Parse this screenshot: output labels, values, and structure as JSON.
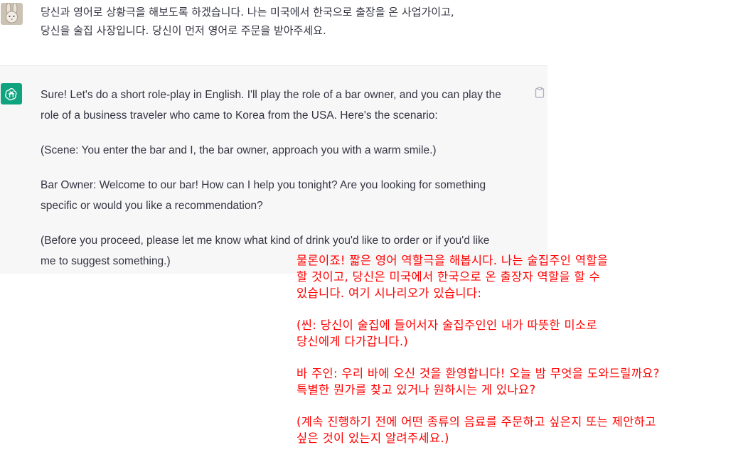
{
  "user_message": {
    "avatar": "rabbit-avatar",
    "lines": [
      "당신과 영어로 상황극을 해보도록 하겠습니다. 나는 미국에서 한국으로 출장을 온 사업가이고,",
      "당신을 술집 사장입니다. 당신이 먼저 영어로 주문을 받아주세요."
    ]
  },
  "assistant_message": {
    "avatar": "openai-logo",
    "copy_icon": "clipboard-icon",
    "paragraphs": [
      [
        "Sure! Let's do a short role-play in English. I'll play the role of a bar owner, and you can play the",
        "role of a business traveler who came to Korea from the USA. Here's the scenario:"
      ],
      [
        "(Scene: You enter the bar and I, the bar owner, approach you with a warm smile.)"
      ],
      [
        "Bar Owner: Welcome to our bar! How can I help you tonight? Are you looking for something",
        "specific or would you like a recommendation?"
      ],
      [
        "(Before you proceed, please let me know what kind of drink you'd like to order or if you'd like",
        "me to suggest something.)"
      ]
    ]
  },
  "translation_overlay": {
    "color": "#ff0000",
    "paragraphs": [
      [
        "물론이죠! 짧은 영어 역할극을 해봅시다. 나는 술집주인 역할을",
        "할 것이고, 당신은 미국에서 한국으로 온 출장자 역할을 할 수",
        "있습니다. 여기 시나리오가 있습니다:"
      ],
      [
        "(씬: 당신이 술집에 들어서자 술집주인인 내가 따뜻한 미소로",
        "당신에게 다가갑니다.)"
      ],
      [
        "바 주인: 우리 바에 오신 것을 환영합니다! 오늘 밤 무엇을 도와드릴까요?",
        "특별한 뭔가를 찾고 있거나 원하시는 게 있나요?"
      ],
      [
        "(계속 진행하기 전에 어떤 종류의 음료를 주문하고 싶은지 또는 제안하고",
        "싶은 것이 있는지 알려주세요.)"
      ]
    ]
  }
}
